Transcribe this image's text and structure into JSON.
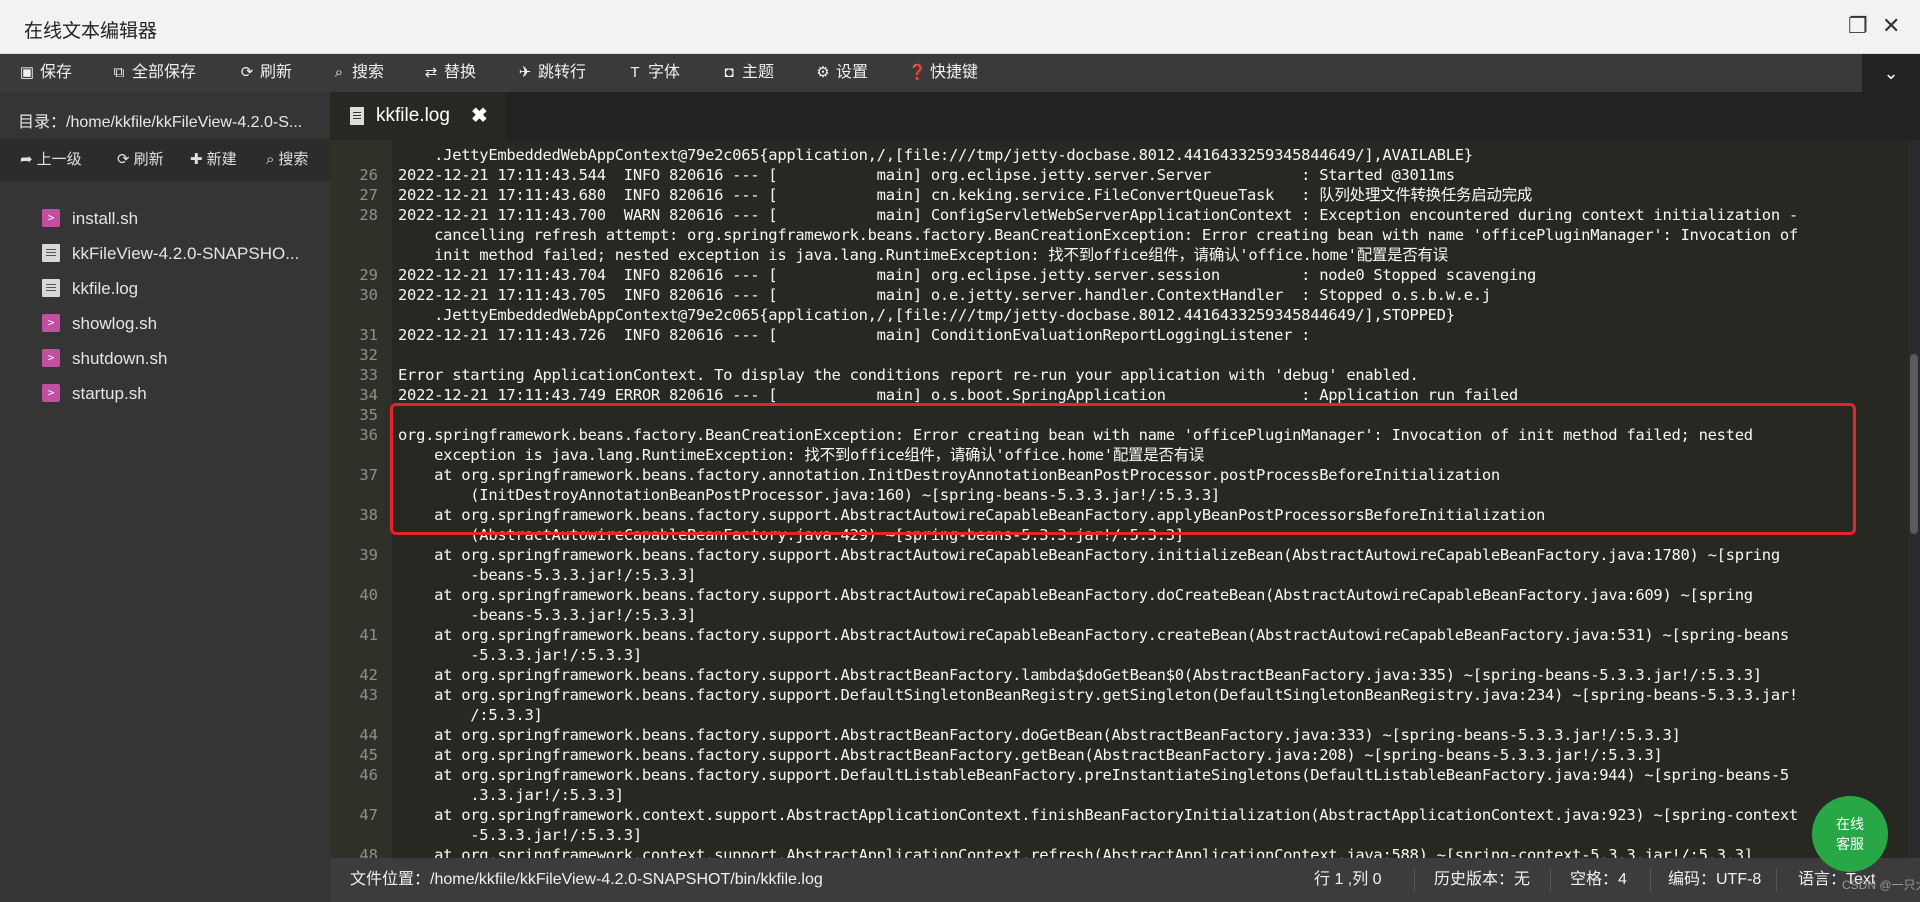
{
  "window": {
    "title": "在线文本编辑器"
  },
  "toolbar": {
    "save": "保存",
    "save_all": "全部保存",
    "refresh": "刷新",
    "search": "搜索",
    "replace": "替换",
    "goto_line": "跳转行",
    "font": "字体",
    "theme": "主题",
    "settings": "设置",
    "shortcuts": "快捷键"
  },
  "sidebar": {
    "path": "目录：/home/kkfile/kkFileView-4.2.0-S...",
    "nav": {
      "up": "上一级",
      "refresh": "刷新",
      "new": "新建",
      "search": "搜索"
    },
    "files": [
      {
        "name": "install.sh",
        "type": "sh"
      },
      {
        "name": "kkFileView-4.2.0-SNAPSHO...",
        "type": "doc"
      },
      {
        "name": "kkfile.log",
        "type": "doc"
      },
      {
        "name": "showlog.sh",
        "type": "sh"
      },
      {
        "name": "shutdown.sh",
        "type": "sh"
      },
      {
        "name": "startup.sh",
        "type": "sh"
      }
    ]
  },
  "tab": {
    "label": "kkfile.log",
    "close": "✖"
  },
  "editor": {
    "lines": [
      {
        "n": "",
        "t": "    .JettyEmbeddedWebAppContext@79e2c065{application,/,[file:///tmp/jetty-docbase.8012.4416433259345844649/],AVAILABLE}"
      },
      {
        "n": "26",
        "t": "2022-12-21 17:11:43.544  INFO 820616 --- [           main] org.eclipse.jetty.server.Server          : Started @3011ms"
      },
      {
        "n": "27",
        "t": "2022-12-21 17:11:43.680  INFO 820616 --- [           main] cn.keking.service.FileConvertQueueTask   : 队列处理文件转换任务启动完成"
      },
      {
        "n": "28",
        "t": "2022-12-21 17:11:43.700  WARN 820616 --- [           main] ConfigServletWebServerApplicationContext : Exception encountered during context initialization -"
      },
      {
        "n": "",
        "t": "    cancelling refresh attempt: org.springframework.beans.factory.BeanCreationException: Error creating bean with name 'officePluginManager': Invocation of"
      },
      {
        "n": "",
        "t": "    init method failed; nested exception is java.lang.RuntimeException: 找不到office组件，请确认'office.home'配置是否有误"
      },
      {
        "n": "29",
        "t": "2022-12-21 17:11:43.704  INFO 820616 --- [           main] org.eclipse.jetty.server.session         : node0 Stopped scavenging"
      },
      {
        "n": "30",
        "t": "2022-12-21 17:11:43.705  INFO 820616 --- [           main] o.e.jetty.server.handler.ContextHandler  : Stopped o.s.b.w.e.j"
      },
      {
        "n": "",
        "t": "    .JettyEmbeddedWebAppContext@79e2c065{application,/,[file:///tmp/jetty-docbase.8012.4416433259345844649/],STOPPED}"
      },
      {
        "n": "31",
        "t": "2022-12-21 17:11:43.726  INFO 820616 --- [           main] ConditionEvaluationReportLoggingListener :"
      },
      {
        "n": "32",
        "t": ""
      },
      {
        "n": "33",
        "t": "Error starting ApplicationContext. To display the conditions report re-run your application with 'debug' enabled."
      },
      {
        "n": "34",
        "t": "2022-12-21 17:11:43.749 ERROR 820616 --- [           main] o.s.boot.SpringApplication               : Application run failed"
      },
      {
        "n": "35",
        "t": ""
      },
      {
        "n": "36",
        "t": "org.springframework.beans.factory.BeanCreationException: Error creating bean with name 'officePluginManager': Invocation of init method failed; nested"
      },
      {
        "n": "",
        "t": "    exception is java.lang.RuntimeException: 找不到office组件，请确认'office.home'配置是否有误"
      },
      {
        "n": "37",
        "t": "    at org.springframework.beans.factory.annotation.InitDestroyAnnotationBeanPostProcessor.postProcessBeforeInitialization"
      },
      {
        "n": "",
        "t": "        (InitDestroyAnnotationBeanPostProcessor.java:160) ~[spring-beans-5.3.3.jar!/:5.3.3]"
      },
      {
        "n": "38",
        "t": "    at org.springframework.beans.factory.support.AbstractAutowireCapableBeanFactory.applyBeanPostProcessorsBeforeInitialization"
      },
      {
        "n": "",
        "t": "        (AbstractAutowireCapableBeanFactory.java:429) ~[spring-beans-5.3.3.jar!/:5.3.3]"
      },
      {
        "n": "39",
        "t": "    at org.springframework.beans.factory.support.AbstractAutowireCapableBeanFactory.initializeBean(AbstractAutowireCapableBeanFactory.java:1780) ~[spring"
      },
      {
        "n": "",
        "t": "        -beans-5.3.3.jar!/:5.3.3]"
      },
      {
        "n": "40",
        "t": "    at org.springframework.beans.factory.support.AbstractAutowireCapableBeanFactory.doCreateBean(AbstractAutowireCapableBeanFactory.java:609) ~[spring"
      },
      {
        "n": "",
        "t": "        -beans-5.3.3.jar!/:5.3.3]"
      },
      {
        "n": "41",
        "t": "    at org.springframework.beans.factory.support.AbstractAutowireCapableBeanFactory.createBean(AbstractAutowireCapableBeanFactory.java:531) ~[spring-beans"
      },
      {
        "n": "",
        "t": "        -5.3.3.jar!/:5.3.3]"
      },
      {
        "n": "42",
        "t": "    at org.springframework.beans.factory.support.AbstractBeanFactory.lambda$doGetBean$0(AbstractBeanFactory.java:335) ~[spring-beans-5.3.3.jar!/:5.3.3]"
      },
      {
        "n": "43",
        "t": "    at org.springframework.beans.factory.support.DefaultSingletonBeanRegistry.getSingleton(DefaultSingletonBeanRegistry.java:234) ~[spring-beans-5.3.3.jar!"
      },
      {
        "n": "",
        "t": "        /:5.3.3]"
      },
      {
        "n": "44",
        "t": "    at org.springframework.beans.factory.support.AbstractBeanFactory.doGetBean(AbstractBeanFactory.java:333) ~[spring-beans-5.3.3.jar!/:5.3.3]"
      },
      {
        "n": "45",
        "t": "    at org.springframework.beans.factory.support.AbstractBeanFactory.getBean(AbstractBeanFactory.java:208) ~[spring-beans-5.3.3.jar!/:5.3.3]"
      },
      {
        "n": "46",
        "t": "    at org.springframework.beans.factory.support.DefaultListableBeanFactory.preInstantiateSingletons(DefaultListableBeanFactory.java:944) ~[spring-beans-5"
      },
      {
        "n": "",
        "t": "        .3.3.jar!/:5.3.3]"
      },
      {
        "n": "47",
        "t": "    at org.springframework.context.support.AbstractApplicationContext.finishBeanFactoryInitialization(AbstractApplicationContext.java:923) ~[spring-context"
      },
      {
        "n": "",
        "t": "        -5.3.3.jar!/:5.3.3]"
      },
      {
        "n": "48",
        "t": "    at org.springframework.context.support.AbstractApplicationContext.refresh(AbstractApplicationContext.java:588) ~[spring-context-5.3.3.jar!/:5.3.3]"
      }
    ]
  },
  "statusbar": {
    "file_path": "文件位置：/home/kkfile/kkFileView-4.2.0-SNAPSHOT/bin/kkfile.log",
    "cursor": "行 1 ,列 0",
    "history": "历史版本：无",
    "indent": "空格：4",
    "encoding": "编码：UTF-8",
    "language": "语言：Text"
  },
  "float_service": {
    "line1": "在线",
    "line2": "客服"
  },
  "watermark": "CSDN @一只大..."
}
